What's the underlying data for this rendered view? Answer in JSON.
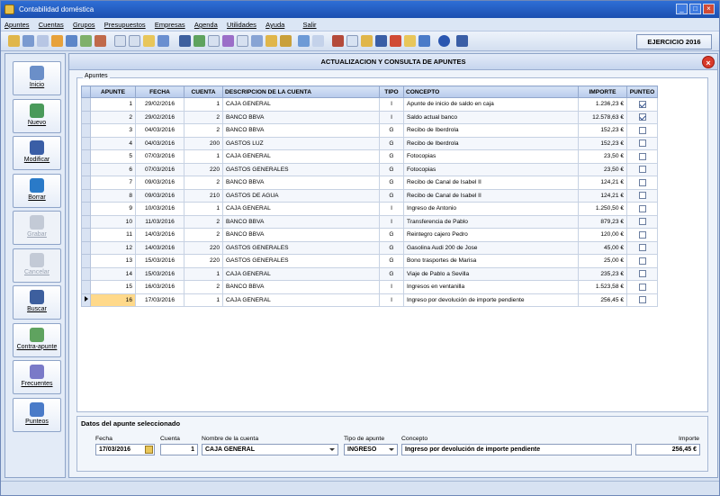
{
  "window": {
    "title": "Contabilidad doméstica"
  },
  "menu": [
    "Apuntes",
    "Cuentas",
    "Grupos",
    "Presupuestos",
    "Empresas",
    "Agenda",
    "Utilidades",
    "Ayuda",
    "Salir"
  ],
  "exercise": "EJERCICIO 2016",
  "sidebar": [
    {
      "label": "Inicio",
      "icon": "home-icon",
      "enabled": true
    },
    {
      "label": "Nuevo",
      "icon": "new-document-icon",
      "enabled": true
    },
    {
      "label": "Modificar",
      "icon": "edit-icon",
      "enabled": true
    },
    {
      "label": "Borrar",
      "icon": "delete-icon",
      "enabled": true
    },
    {
      "label": "Grabar",
      "icon": "save-check-icon",
      "enabled": false
    },
    {
      "label": "Cancelar",
      "icon": "cancel-x-icon",
      "enabled": false
    },
    {
      "label": "Buscar",
      "icon": "binoculars-icon",
      "enabled": true
    },
    {
      "label": "Contra-apunte",
      "icon": "counter-entry-icon",
      "enabled": true
    },
    {
      "label": "Frecuentes",
      "icon": "frequent-icon",
      "enabled": true
    },
    {
      "label": "Punteos",
      "icon": "checklist-icon",
      "enabled": true
    }
  ],
  "main": {
    "header": "ACTUALIZACION Y CONSULTA DE APUNTES",
    "frame_label": "Apuntes",
    "columns": [
      "APUNTE",
      "FECHA",
      "CUENTA",
      "DESCRIPCION DE LA CUENTA",
      "TIPO",
      "CONCEPTO",
      "IMPORTE",
      "PUNTEO"
    ],
    "rows": [
      [
        "1",
        "29/02/2016",
        "1",
        "CAJA GENERAL",
        "I",
        "Apunte de inicio de saldo en caja",
        "1.236,23 €",
        true
      ],
      [
        "2",
        "29/02/2016",
        "2",
        "BANCO BBVA",
        "I",
        "Saldo actual banco",
        "12.578,63 €",
        true
      ],
      [
        "3",
        "04/03/2016",
        "2",
        "BANCO BBVA",
        "G",
        "Recibo de Iberdrola",
        "152,23 €",
        false
      ],
      [
        "4",
        "04/03/2016",
        "200",
        "GASTOS LUZ",
        "G",
        "Recibo de Iberdrola",
        "152,23 €",
        false
      ],
      [
        "5",
        "07/03/2016",
        "1",
        "CAJA GENERAL",
        "G",
        "Fotocopias",
        "23,50 €",
        false
      ],
      [
        "6",
        "07/03/2016",
        "220",
        "GASTOS GENERALES",
        "G",
        "Fotocopias",
        "23,50 €",
        false
      ],
      [
        "7",
        "09/03/2016",
        "2",
        "BANCO BBVA",
        "G",
        "Recibo de Canal de Isabel II",
        "124,21 €",
        false
      ],
      [
        "8",
        "09/03/2016",
        "210",
        "GASTOS DE AGUA",
        "G",
        "Recibo de Canal de Isabel II",
        "124,21 €",
        false
      ],
      [
        "9",
        "10/03/2016",
        "1",
        "CAJA GENERAL",
        "I",
        "Ingreso de Antonio",
        "1.250,50 €",
        false
      ],
      [
        "10",
        "11/03/2016",
        "2",
        "BANCO BBVA",
        "I",
        "Transferencia de Pablo",
        "879,23 €",
        false
      ],
      [
        "11",
        "14/03/2016",
        "2",
        "BANCO BBVA",
        "G",
        "Reintegro cajero Pedro",
        "120,00 €",
        false
      ],
      [
        "12",
        "14/03/2016",
        "220",
        "GASTOS GENERALES",
        "G",
        "Gasolina Audi 200 de Jose",
        "45,00 €",
        false
      ],
      [
        "13",
        "15/03/2016",
        "220",
        "GASTOS GENERALES",
        "G",
        "Bono trasportes de Marisa",
        "25,00 €",
        false
      ],
      [
        "14",
        "15/03/2016",
        "1",
        "CAJA GENERAL",
        "G",
        "Viaje de Pablo a Sevilla",
        "235,23 €",
        false
      ],
      [
        "15",
        "16/03/2016",
        "2",
        "BANCO BBVA",
        "I",
        "Ingresos en ventanilla",
        "1.523,58 €",
        false
      ],
      [
        "16",
        "17/03/2016",
        "1",
        "CAJA GENERAL",
        "I",
        "Ingreso por devolución de importe pendiente",
        "256,45 €",
        false
      ]
    ]
  },
  "details": {
    "title": "Datos del apunte seleccionado",
    "fecha_label": "Fecha",
    "fecha": "17/03/2016",
    "cuenta_label": "Cuenta",
    "cuenta": "1",
    "nombre_label": "Nombre de la cuenta",
    "nombre": "CAJA GENERAL",
    "tipo_label": "Tipo de apunte",
    "tipo": "INGRESO",
    "concepto_label": "Concepto",
    "concepto": "Ingreso por devolución de importe pendiente",
    "importe_label": "Importe",
    "importe": "256,45 €"
  }
}
